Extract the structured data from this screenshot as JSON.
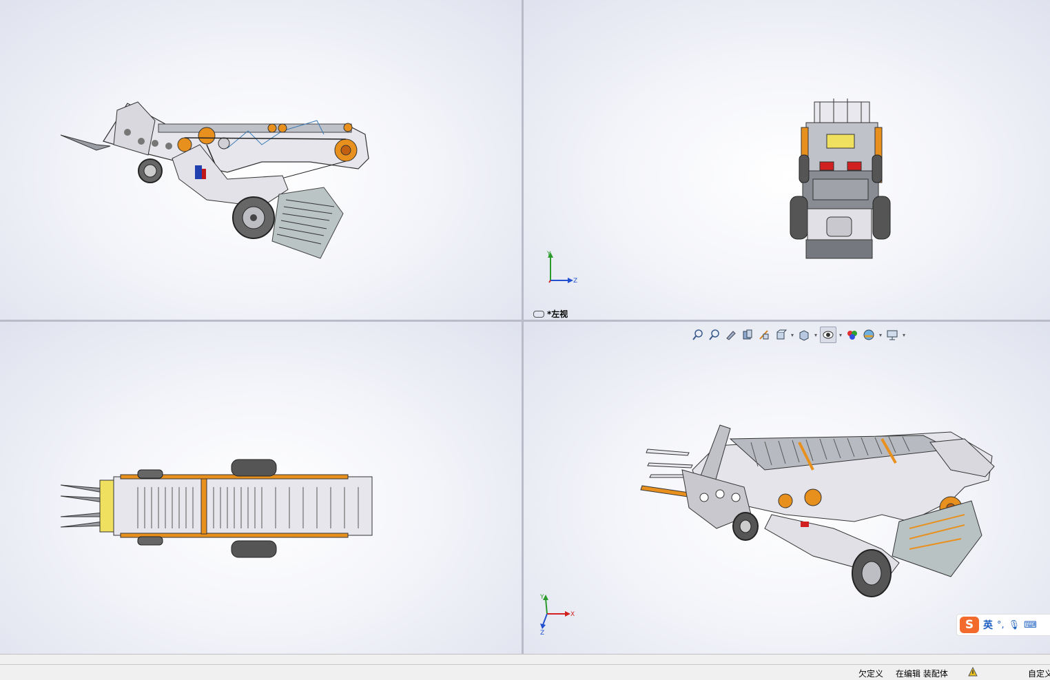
{
  "viewports": {
    "top_right": {
      "view_name": "*左视"
    }
  },
  "triad_labels": {
    "left_view": {
      "y": "Y",
      "z": "Z"
    },
    "iso_view": {
      "y": "Y",
      "x": "X",
      "z": "Z"
    }
  },
  "heads_up_toolbar": {
    "items": [
      {
        "icon": "zoom-to-fit-icon"
      },
      {
        "icon": "zoom-to-area-icon"
      },
      {
        "icon": "previous-view-icon"
      },
      {
        "icon": "section-view-icon"
      },
      {
        "icon": "dynamic-annotation-views-icon"
      },
      {
        "icon": "view-orientation-icon"
      },
      {
        "icon": "display-style-icon"
      },
      {
        "icon": "hide-show-items-icon"
      },
      {
        "icon": "edit-appearance-icon"
      },
      {
        "icon": "apply-scene-icon"
      },
      {
        "icon": "view-settings-icon"
      }
    ]
  },
  "ime": {
    "lang": "英",
    "punct": "°,",
    "logo": "S"
  },
  "status_bar": {
    "state": "欠定义",
    "editing": "在编辑 装配体",
    "custom": "自定义"
  },
  "colors": {
    "accent_orange": "#e8901e",
    "frame_gray": "#8a8c94",
    "axis_x": "#d22020",
    "axis_y": "#2a9a2a",
    "axis_z": "#2050d0"
  }
}
